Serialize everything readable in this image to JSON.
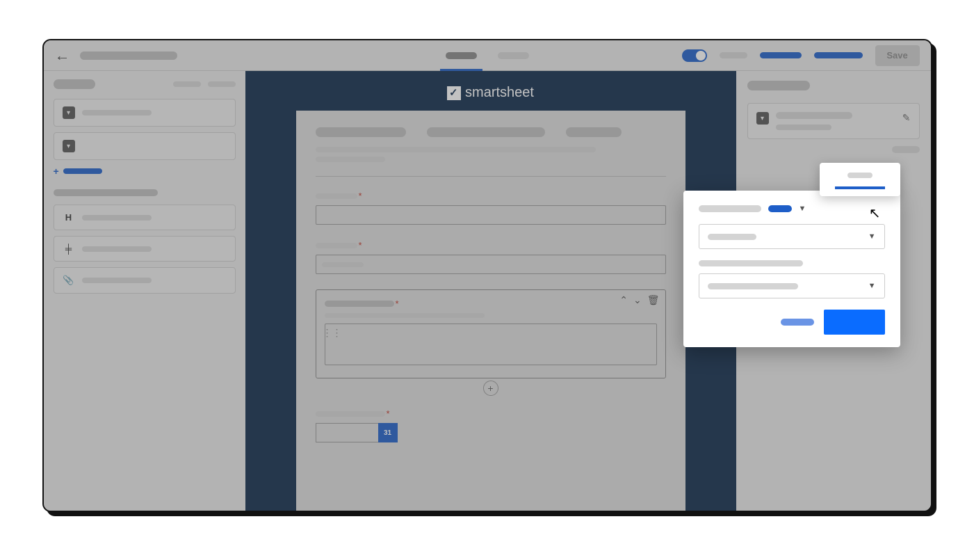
{
  "header": {
    "save_label": "Save"
  },
  "logo": {
    "text": "smartsheet"
  },
  "calendar": {
    "day": "31"
  },
  "required_marker": "*"
}
